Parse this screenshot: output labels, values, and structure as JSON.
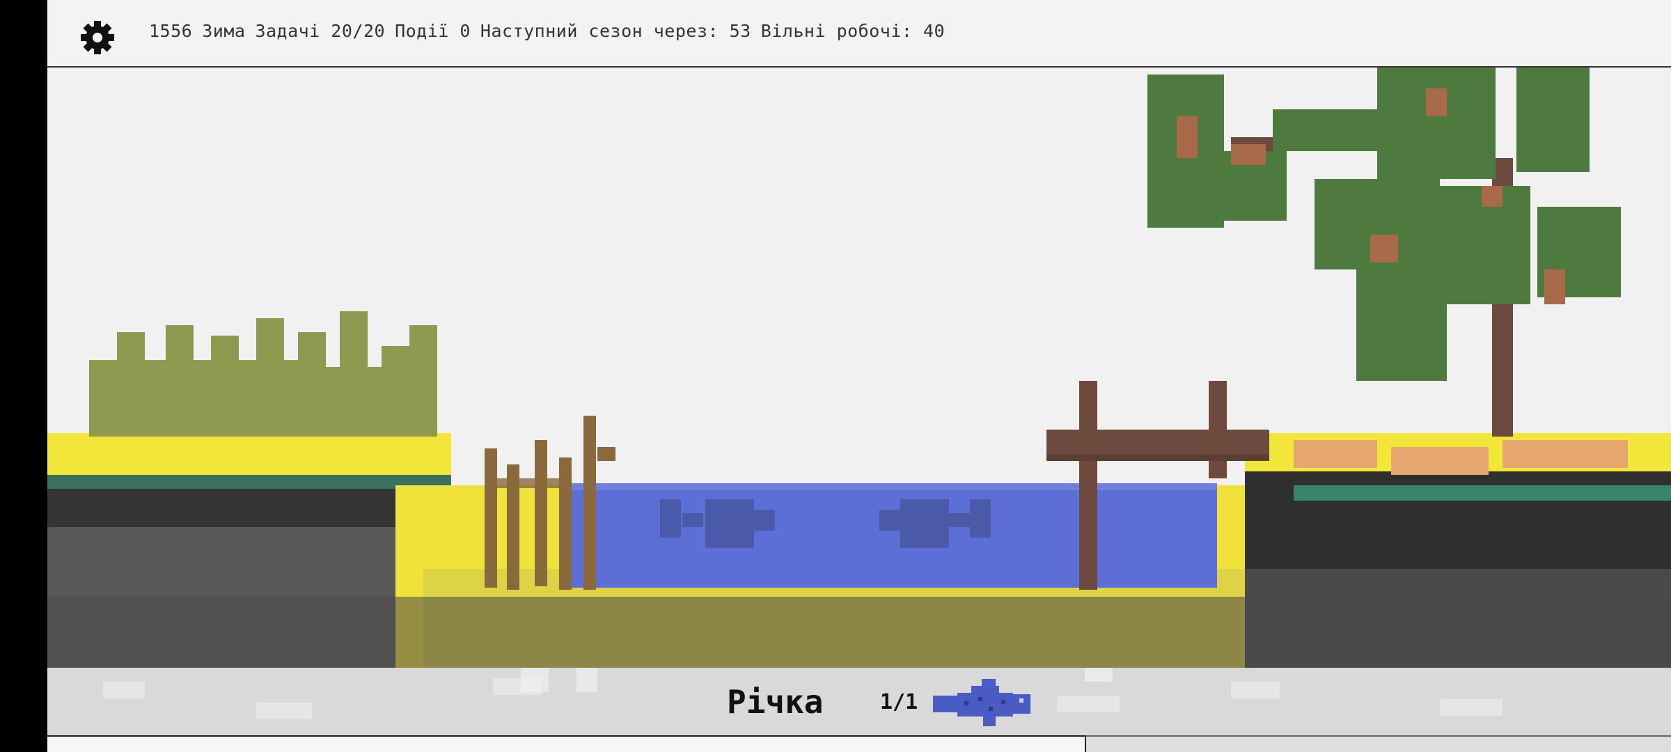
{
  "status": {
    "year": "1556",
    "season": "Зима",
    "tasks": "Задачі 20/20",
    "events": "Події 0",
    "next_season": "Наступний сезон через: 53",
    "free_workers": "Вільні робочі: 40"
  },
  "location": {
    "title": "Річка",
    "count": "1/1"
  },
  "icons": {
    "settings": "gear-icon",
    "location_resource": "fish-icon"
  },
  "colors": {
    "sky": "#f1f1f1",
    "water": "#5b6fd6",
    "sand": "#f2e63a",
    "soil": "#2f2f2f",
    "grass_teal": "#3f9a7c",
    "bush": "#8f9a50",
    "leaves": "#4f7a3f",
    "trunk": "#6e4a3e",
    "fish": "#4a5bc4"
  }
}
